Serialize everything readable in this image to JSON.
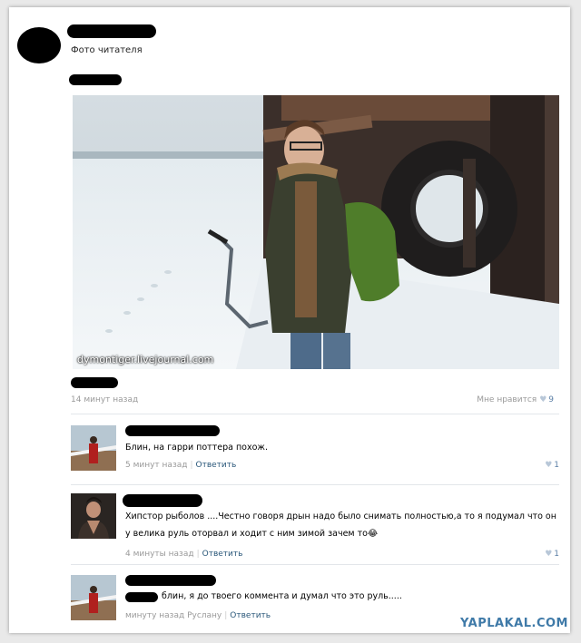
{
  "post": {
    "subtitle": "Фото читателя",
    "watermark": "dymontiger.livejournal.com",
    "time": "14 минут назад",
    "likes_label": "Мне нравится",
    "likes_count": "9"
  },
  "comments": [
    {
      "text": "Блин, на гарри поттера похож.",
      "time": "5 минут назад",
      "reply_label": "Ответить",
      "likes": "1"
    },
    {
      "text_line1": "Хипстор рыболов ....Честно говоря дрын надо было снимать полностью,а то я подумал что он",
      "text_line2": "у велика руль оторвал и ходит с ним зимой зачем то😂",
      "time": "4 минуты назад",
      "reply_label": "Ответить",
      "likes": "1"
    },
    {
      "text": "блин, я до твоего коммента и думал что это руль.....",
      "time": "минуту назад Руслану",
      "reply_label": "Ответить"
    }
  ],
  "brand": "YAPLAKAL.COM",
  "icons": {
    "heart": "heart-icon"
  }
}
